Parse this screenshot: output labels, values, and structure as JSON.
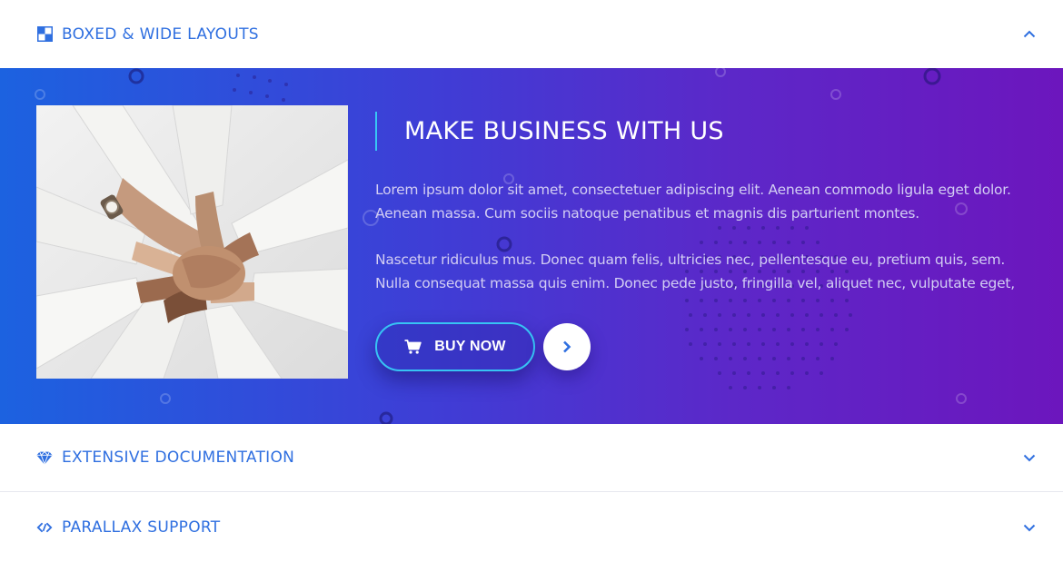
{
  "accordion": {
    "items": [
      {
        "title": "BOXED & WIDE LAYOUTS",
        "icon": "layout-squares-icon",
        "expanded": true,
        "chevron": "chevron-up-icon"
      },
      {
        "title": "EXTENSIVE DOCUMENTATION",
        "icon": "diamond-icon",
        "expanded": false,
        "chevron": "chevron-down-icon"
      },
      {
        "title": "PARALLAX SUPPORT",
        "icon": "parallax-arrows-icon",
        "expanded": false,
        "chevron": "chevron-down-icon"
      }
    ]
  },
  "panel": {
    "heading": "MAKE BUSINESS WITH US",
    "paragraph1": "Lorem ipsum dolor sit amet, consectetuer adipiscing elit. Aenean commodo ligula eget dolor. Aenean massa. Cum sociis natoque penatibus et magnis dis parturient montes.",
    "paragraph2": "Nascetur ridiculus mus. Donec quam felis, ultricies nec, pellentesque eu, pretium quis, sem. Nulla consequat massa quis enim. Donec pede justo, fringilla vel, aliquet nec, vulputate eget,",
    "buy_button": {
      "label": "BUY NOW",
      "icon": "cart-icon"
    },
    "next_button": {
      "icon": "chevron-right-icon"
    },
    "image": "team-hands-stacked-photo"
  },
  "colors": {
    "accent_blue": "#2f6fe0",
    "gradient_start": "#1c62e0",
    "gradient_end": "#6c16bd",
    "button_border": "#37c3f4",
    "divider": "#38c6f4"
  }
}
